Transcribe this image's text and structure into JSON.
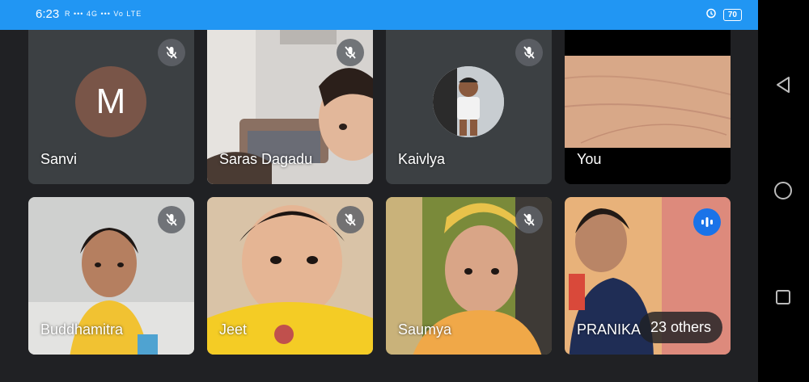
{
  "status_bar": {
    "time": "6:23",
    "network": "R ••• 4G ••• Vo LTE",
    "battery": "70"
  },
  "tiles": [
    {
      "name": "Sanvi",
      "avatar_letter": "M",
      "muted": true,
      "avatar_color": "#795548"
    },
    {
      "name": "Saras Dagadu",
      "muted": true
    },
    {
      "name": "Kaivlya",
      "muted": true
    },
    {
      "name": "You",
      "muted": false
    },
    {
      "name": "Buddhamitra",
      "muted": true
    },
    {
      "name": "Jeet",
      "muted": true
    },
    {
      "name": "Saumya",
      "muted": true
    },
    {
      "name": "PRANIKA",
      "speaking": true
    }
  ],
  "others_label": "23 others",
  "colors": {
    "status_bar": "#2196f3",
    "background": "#202124",
    "tile": "#3c4043",
    "speaking_indicator": "#1a73e8"
  }
}
